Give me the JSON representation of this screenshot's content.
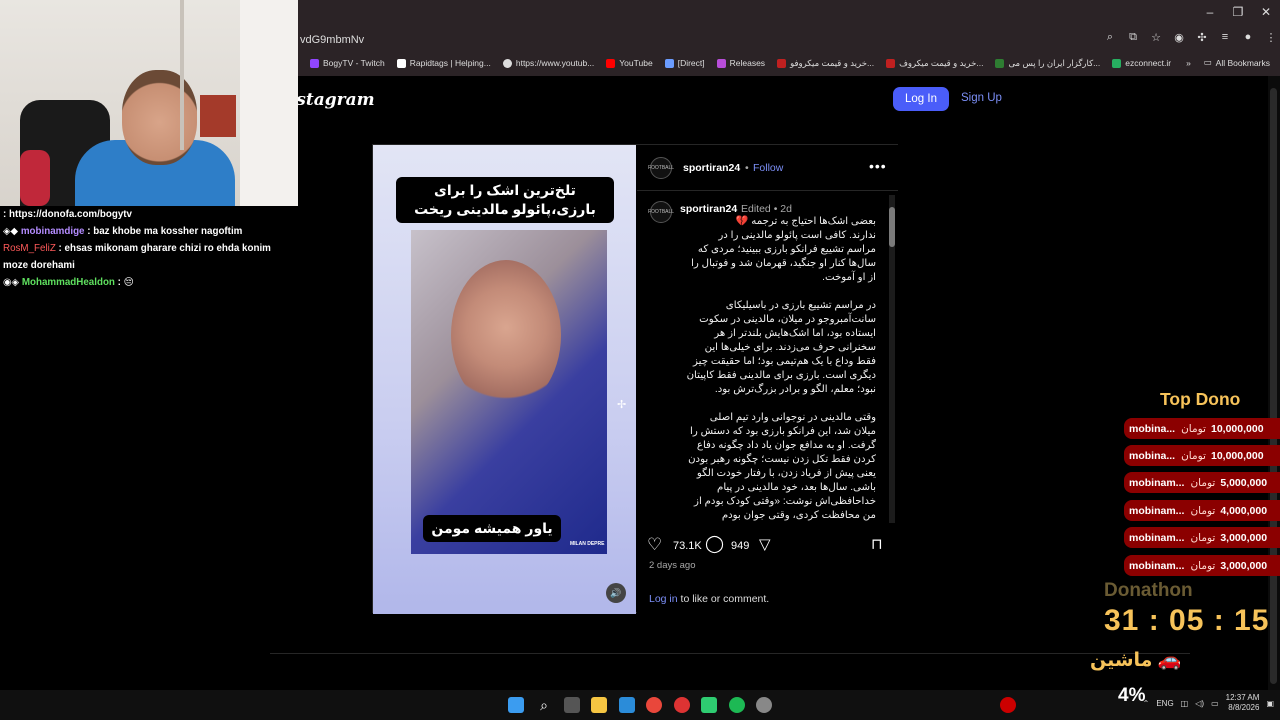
{
  "browser": {
    "url": "vdG9mbmNv",
    "bookmarks": [
      "BogyTV - Twitch",
      "Rapidtags | Helping...",
      "https://www.youtub...",
      "YouTube",
      "[Direct]",
      "Releases",
      "خرید و قیمت میکروفو...",
      "خرید و قیمت میکروف...",
      "کارگزار ایران را پس می...",
      "ezconnect.ir"
    ],
    "all_bookmarks": "All Bookmarks",
    "window_controls": [
      "–",
      "❐",
      "✕"
    ]
  },
  "instagram": {
    "logo": "Instagram",
    "login": "Log In",
    "signup": "Sign Up",
    "post": {
      "author": "sportiran24",
      "follow": "Follow",
      "follow_sep": "•",
      "more": "•••",
      "caption_user": "sportiran24",
      "caption_meta": "Edited • 2d",
      "caption_text": "بعضی اشک‌ها احتیاج به ترجمه 💔\nندارند. کافی است پائولو مالدینی را در\nمراسم تشییع فرانکو بارزی ببینید؛ مردی که\nسال‌ها کنار او جنگید، قهرمان شد و فوتبال را\nاز او آموخت.\n\nدر مراسم تشییع بارزی در باسیلیکای\nسانت‌آمبروجو در میلان، مالدینی در سکوت\nایستاده بود، اما اشک‌هایش بلندتر از هر\nسخنرانی حرف می‌زدند. برای خیلی‌ها این\nفقط وداع با یک هم‌تیمی بود؛ اما حقیقت چیز\nدیگری است. بارزی برای مالدینی فقط کاپیتان\nنبود؛ معلم، الگو و برادر بزرگ‌ترش بود.\n\nوقتی مالدینی در نوجوانی وارد تیم اصلی\nمیلان شد، این فرانکو بارزی بود که دستش را\nگرفت. او به مدافع جوان یاد داد چگونه دفاع\nکردن فقط تکل زدن نیست؛ چگونه رهبر بودن\nیعنی پیش از فریاد زدن، با رفتار خودت الگو\nباشی. سال‌ها بعد، خود مالدینی در پیام\nخداحافظی‌اش نوشت: «وقتی کودک بودم از\nمن محافظت کردی، وقتی جوان بودم",
      "video_caption_top": "تلخ‌ترین اشک را برای بارزی،پائولو مالدینی ریخت",
      "video_caption_bottom": "یاور همیشه مومن",
      "watermark": "MILAN DEPRE",
      "avatar_text": "FOOTBALL",
      "likes": "73.1K",
      "comments": "949",
      "time_ago": "2 days ago",
      "login_prompt_link": "Log in",
      "login_prompt_rest": " to like or comment."
    }
  },
  "stream_overlay": {
    "chat": [
      {
        "user": "",
        "text": ": https://donofa.com/bogytv",
        "color": "#ffffff"
      },
      {
        "user": "mobinamdige",
        "text": ": baz khobe ma kossher nagoftim",
        "color": "#b48cff"
      },
      {
        "user": "RosM_FeliZ",
        "text": ": ehsas mikonam gharare chizi ro ehda konim moze dorehami",
        "color": "#ff5a5a"
      },
      {
        "user": "MohammadHealdon",
        "text": ": 😔",
        "color": "#5fe05f"
      }
    ],
    "top_dono_title": "Top Dono",
    "currency": "تومان",
    "donations": [
      {
        "name": "mobina...",
        "amount": "10,000,000"
      },
      {
        "name": "mobina...",
        "amount": "10,000,000"
      },
      {
        "name": "mobinam...",
        "amount": "5,000,000"
      },
      {
        "name": "mobinam...",
        "amount": "4,000,000"
      },
      {
        "name": "mobinam...",
        "amount": "3,000,000"
      },
      {
        "name": "mobinam...",
        "amount": "3,000,000"
      }
    ],
    "donathon_label": "Donathon",
    "timer": "31 : 05 : 15",
    "goal": "🚗 ماشین",
    "percent": "4%"
  },
  "taskbar": {
    "lang": "ENG",
    "time": "12:37 AM",
    "date": "8/8/2026"
  }
}
